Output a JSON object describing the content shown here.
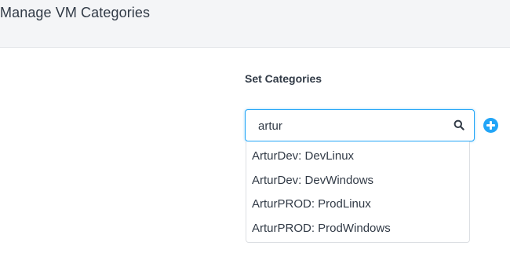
{
  "header": {
    "title": "Manage VM Categories"
  },
  "form": {
    "section_label": "Set Categories",
    "search": {
      "value": "artur",
      "icon": "search-icon"
    },
    "add_button_icon": "plus-circle-icon",
    "suggestions": [
      "ArturDev: DevLinux",
      "ArturDev: DevWindows",
      "ArturPROD: ProdLinux",
      "ArturPROD: ProdWindows"
    ]
  },
  "colors": {
    "accent": "#22a5f7",
    "text": "#313a46",
    "header_bg": "#f4f5f7"
  }
}
